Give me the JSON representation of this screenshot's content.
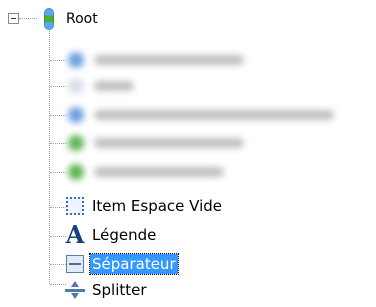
{
  "tree": {
    "root": {
      "label": "Root",
      "icon": "traffic-light-icon",
      "expanded": true
    },
    "children": [
      {
        "label": "Item Espace Vide",
        "icon": "dotted-square-icon"
      },
      {
        "label": "Légende",
        "icon": "letter-a-icon"
      },
      {
        "label": "Séparateur",
        "icon": "separator-icon",
        "selected": true
      },
      {
        "label": "Splitter",
        "icon": "splitter-icon"
      }
    ]
  },
  "colors": {
    "selection": "#3399ff",
    "icon_blue": "#17407e",
    "guide_lines": "#a0a0a0"
  }
}
